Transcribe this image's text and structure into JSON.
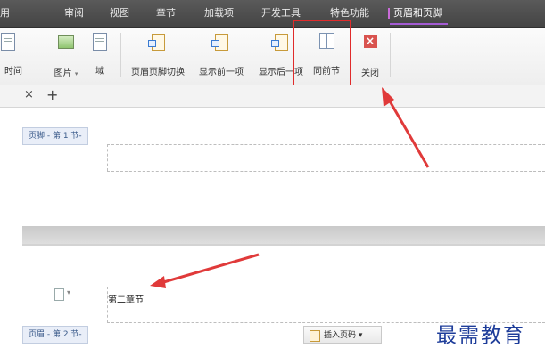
{
  "menu_tabs": [
    "用",
    "审阅",
    "视图",
    "章节",
    "加载项",
    "开发工具",
    "特色功能",
    "页眉和页脚"
  ],
  "ribbon": {
    "time_label": "时间",
    "picture_label": "图片",
    "field_label": "域",
    "switch_label": "页眉页脚切换",
    "prev_label": "显示前一项",
    "next_label": "显示后一项",
    "same_as_prev_label": "同前节",
    "close_label": "关闭"
  },
  "doc_tabs": {
    "close_glyph": "×",
    "add_glyph": "+"
  },
  "section1": {
    "footer_label": "页脚 - 第 1 节-"
  },
  "section2": {
    "header_label": "页眉 - 第 2 节-",
    "text": "第二章节",
    "insert_page_number": "插入页码",
    "dropdown_glyph": "▾"
  },
  "watermark": "最需教育",
  "colors": {
    "highlight": "#e02b2b",
    "arrow": "#e03a3a",
    "active_tab_accent": "#a35bd3",
    "watermark": "#1e3d9a"
  }
}
